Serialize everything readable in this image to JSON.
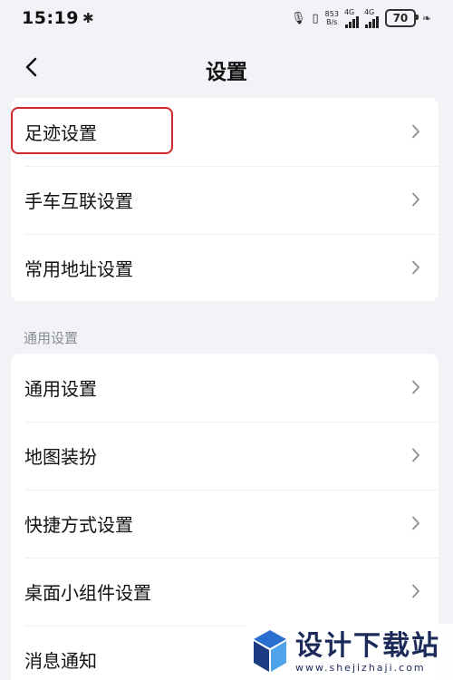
{
  "status_bar": {
    "time": "15:19",
    "net_speed_value": "853",
    "net_speed_unit": "B/s",
    "signal_1_label": "4G",
    "signal_2_label": "4G",
    "battery_level": "70"
  },
  "header": {
    "title": "设置"
  },
  "group1": {
    "items": [
      {
        "label": "足迹设置",
        "highlighted": true
      },
      {
        "label": "手车互联设置"
      },
      {
        "label": "常用地址设置"
      }
    ]
  },
  "section_general": {
    "header": "通用设置",
    "items": [
      {
        "label": "通用设置"
      },
      {
        "label": "地图装扮"
      },
      {
        "label": "快捷方式设置"
      },
      {
        "label": "桌面小组件设置"
      },
      {
        "label": "消息通知"
      }
    ]
  },
  "watermark": {
    "title": "设计下载站",
    "url": "www.shejizhaji.com"
  },
  "colors": {
    "highlight_border": "#d0262e",
    "page_bg": "#f1f3f7",
    "card_bg": "#ffffff"
  }
}
